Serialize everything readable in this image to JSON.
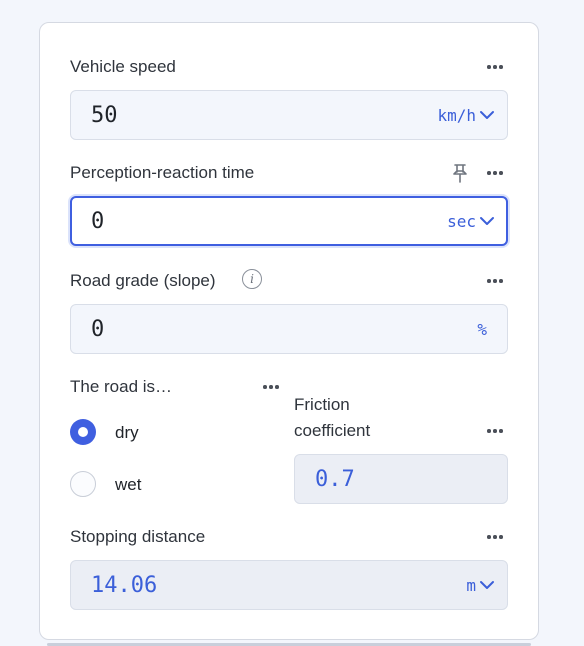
{
  "vehicle_speed": {
    "label": "Vehicle speed",
    "value": "50",
    "unit": "km/h"
  },
  "reaction_time": {
    "label": "Perception-reaction time",
    "value": "0",
    "unit": "sec"
  },
  "road_grade": {
    "label": "Road grade (slope)",
    "info_glyph": "i",
    "value": "0",
    "unit": "%"
  },
  "road_condition": {
    "label": "The road is…",
    "options": [
      "dry",
      "wet"
    ],
    "selected": "dry"
  },
  "friction": {
    "label_line1": "Friction",
    "label_line2": "coefficient",
    "value": "0.7"
  },
  "stopping_distance": {
    "label": "Stopping distance",
    "value": "14.06",
    "unit": "m"
  },
  "icons": {
    "more": "more-dots-icon",
    "pin": "pin-icon",
    "info": "info-icon",
    "unit_dropdown": "chevron-down-icon"
  },
  "colors": {
    "accent": "#3f5fe0",
    "value_blue": "#3b5fd9",
    "field_bg": "#f3f6fc",
    "readonly_bg": "#ebeef5"
  }
}
